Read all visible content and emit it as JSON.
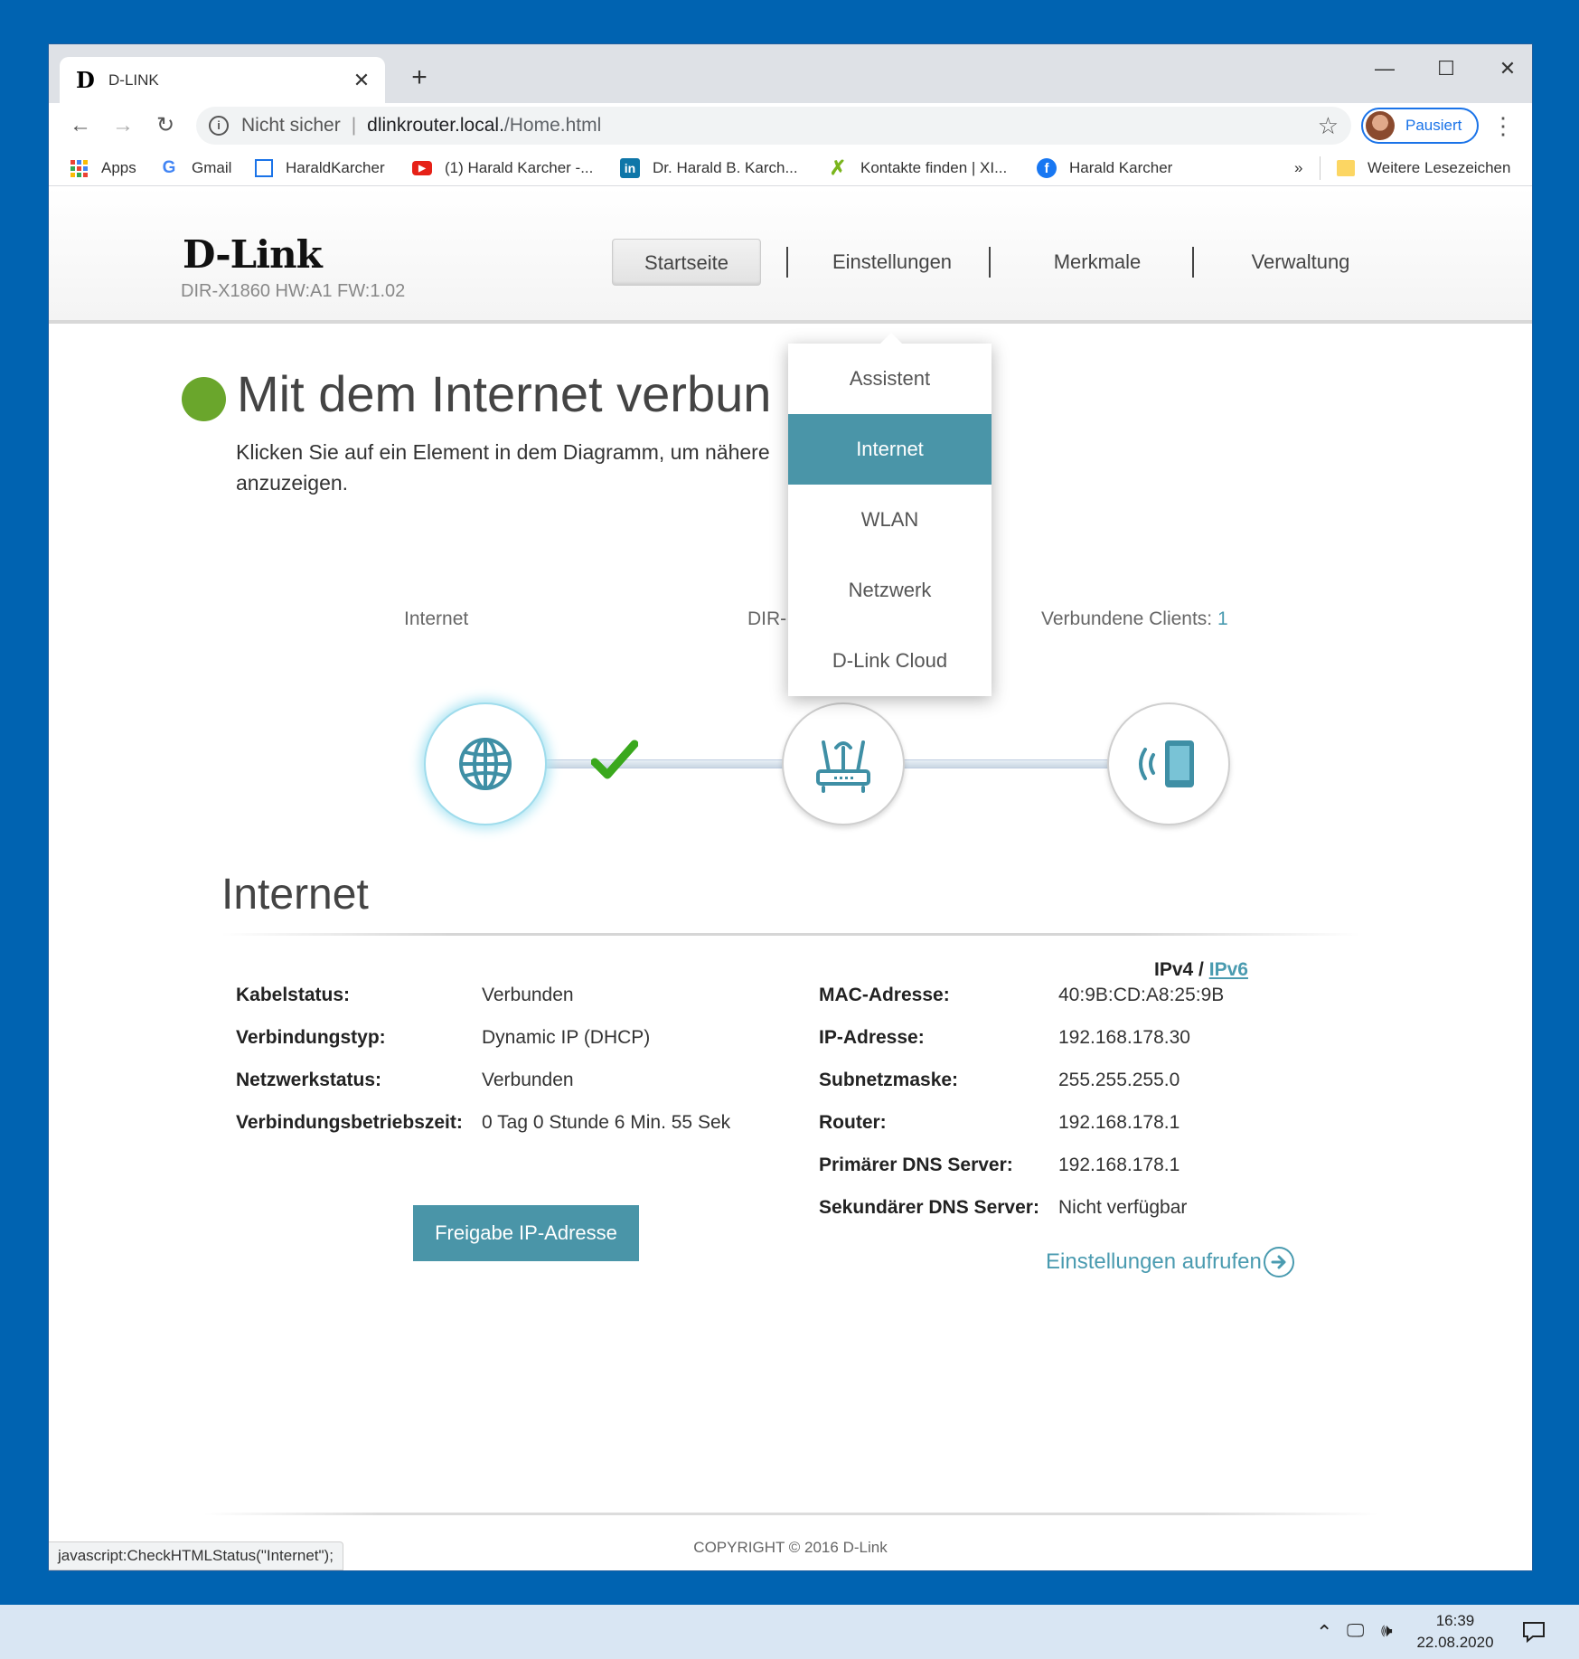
{
  "browser": {
    "tab_title": "D-LINK",
    "tab_favicon": "D",
    "tab_close": "✕",
    "new_tab": "+",
    "minimize": "—",
    "maximize": "☐",
    "close": "✕",
    "address": {
      "security_label": "Nicht sicher",
      "separator": "|",
      "host": "dlinkrouter.local.",
      "path": "/Home.html"
    },
    "profile_label": "Pausiert",
    "bookmarks": [
      {
        "label": "Apps"
      },
      {
        "label": "Gmail"
      },
      {
        "label": "HaraldKarcher"
      },
      {
        "label": "(1) Harald Karcher -..."
      },
      {
        "label": "Dr. Harald B. Karch..."
      },
      {
        "label": "Kontakte finden | XI..."
      },
      {
        "label": "Harald Karcher"
      }
    ],
    "bookmarks_overflow": "»",
    "other_bookmarks": "Weitere Lesezeichen",
    "status_url": "javascript:CheckHTMLStatus(\"Internet\");"
  },
  "router": {
    "logo": "D-Link",
    "model": "DIR-X1860 HW:A1 FW:1.02",
    "nav": [
      "Startseite",
      "Einstellungen",
      "Merkmale",
      "Verwaltung"
    ],
    "dropdown": [
      "Assistent",
      "Internet",
      "WLAN",
      "Netzwerk",
      "D-Link Cloud"
    ],
    "status_title": "Mit dem Internet verbun",
    "instruction": "Klicken Sie auf ein Element in dem Diagramm, um nähere",
    "instruction_line2": "anzuzeigen.",
    "diagram": {
      "internet_label": "Internet",
      "router_label": "DIR-",
      "clients_label": "Verbundene Clients:",
      "clients_count": "1"
    },
    "section_title": "Internet",
    "ip_toggle": {
      "ipv4": "IPv4",
      "slash": "/",
      "ipv6": "IPv6"
    },
    "left_info": [
      {
        "key": "Kabelstatus:",
        "value": "Verbunden"
      },
      {
        "key": "Verbindungstyp:",
        "value": "Dynamic IP (DHCP)"
      },
      {
        "key": "Netzwerkstatus:",
        "value": "Verbunden"
      },
      {
        "key": "Verbindungsbetriebszeit:",
        "value": "0 Tag 0 Stunde 6 Min. 55 Sek"
      }
    ],
    "right_info": [
      {
        "key": "MAC-Adresse:",
        "value": "40:9B:CD:A8:25:9B"
      },
      {
        "key": "IP-Adresse:",
        "value": "192.168.178.30"
      },
      {
        "key": "Subnetzmaske:",
        "value": "255.255.255.0"
      },
      {
        "key": "Router:",
        "value": "192.168.178.1"
      },
      {
        "key": "Primärer DNS Server:",
        "value": "192.168.178.1"
      },
      {
        "key": "Sekundärer DNS Server:",
        "value": "Nicht verfügbar"
      }
    ],
    "release_button": "Freigabe IP-Adresse",
    "settings_link": "Einstellungen aufrufen",
    "copyright": "COPYRIGHT © 2016 D-Link",
    "colors": {
      "accent": "#4a95a8",
      "connected": "#6aa62c"
    }
  },
  "taskbar": {
    "time": "16:39",
    "date": "22.08.2020"
  }
}
